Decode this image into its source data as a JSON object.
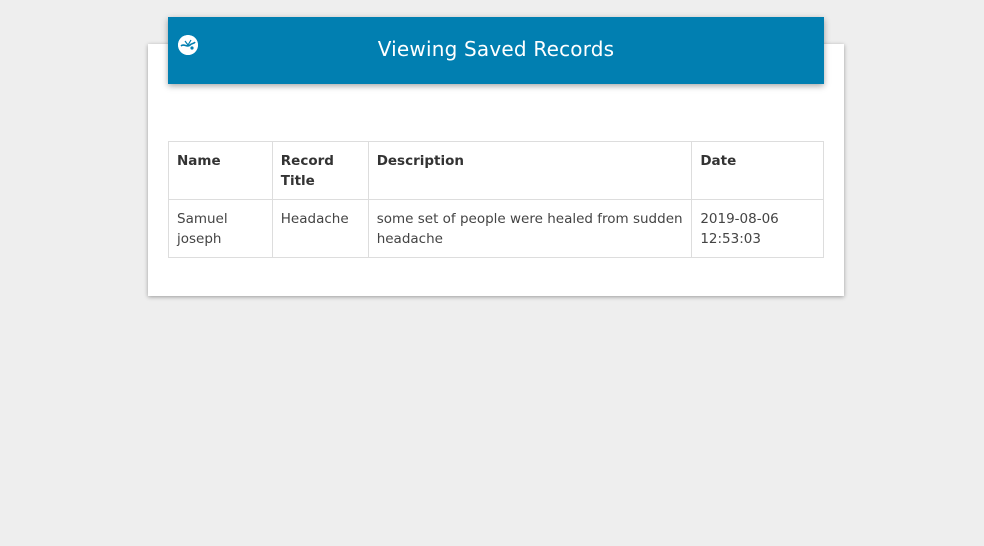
{
  "header": {
    "title": "Viewing Saved Records",
    "logo_icon": "caduceus-logo-icon",
    "background_color": "#017fb1"
  },
  "table": {
    "columns": [
      "Name",
      "Record Title",
      "Description",
      "Date"
    ],
    "rows": [
      {
        "name": "Samuel joseph",
        "record_title": "Headache",
        "description": "some set of people were healed from sudden headache",
        "date": "2019-08-06 12:53:03"
      }
    ]
  }
}
